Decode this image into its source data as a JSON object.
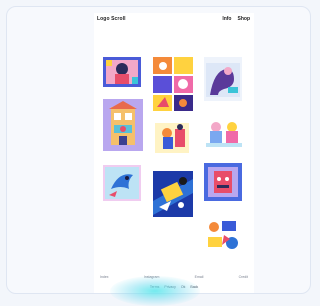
{
  "header": {
    "logo": "Logo Scroll",
    "nav": [
      "Info",
      "Shop"
    ]
  },
  "gallery": {
    "items": [
      {
        "name": "art-portrait-pink"
      },
      {
        "name": "art-collage-orange"
      },
      {
        "name": "art-figure-purple"
      },
      {
        "name": "art-building-lavender"
      },
      {
        "name": "art-characters-pastel"
      },
      {
        "name": "art-scene-yellow"
      },
      {
        "name": "art-bird-blue"
      },
      {
        "name": "art-diagonal-blue"
      },
      {
        "name": "art-face-framed"
      },
      {
        "name": "art-objects-small"
      }
    ]
  },
  "footer": {
    "row1": [
      "Index",
      "Instagram",
      "Email",
      "Credit"
    ],
    "row2": [
      "Terms",
      "Privacy",
      "Ok",
      "Back"
    ]
  },
  "colors": {
    "background": "#f3f6fb",
    "page": "#ffffff",
    "glow": "#5ae6eb"
  }
}
